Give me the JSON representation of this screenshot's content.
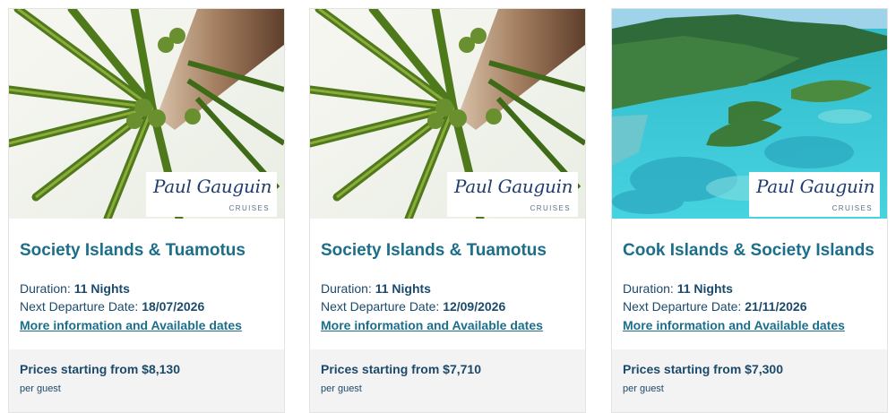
{
  "brand": {
    "logo_script": "Paul Gauguin",
    "logo_sub": "CRUISES",
    "colors": {
      "title": "#1c6e8a",
      "text": "#1b4a6b",
      "logo": "#1e3d6e",
      "footer_bg": "#f3f3f3"
    }
  },
  "labels": {
    "duration": "Duration:",
    "next_departure": "Next Departure Date:",
    "more_info": "More information and Available dates",
    "prices_from": "Prices starting from",
    "per_guest": "per guest"
  },
  "cruises": [
    {
      "image": "palm-tree-photo",
      "title": "Society Islands & Tuamotus",
      "duration": "11 Nights",
      "departure": "18/07/2026",
      "price": "$8,130"
    },
    {
      "image": "palm-tree-photo",
      "title": "Society Islands & Tuamotus",
      "duration": "11 Nights",
      "departure": "12/09/2026",
      "price": "$7,710"
    },
    {
      "image": "island-lagoon-photo",
      "title": "Cook Islands & Society Islands",
      "duration": "11 Nights",
      "departure": "21/11/2026",
      "price": "$7,300"
    }
  ]
}
